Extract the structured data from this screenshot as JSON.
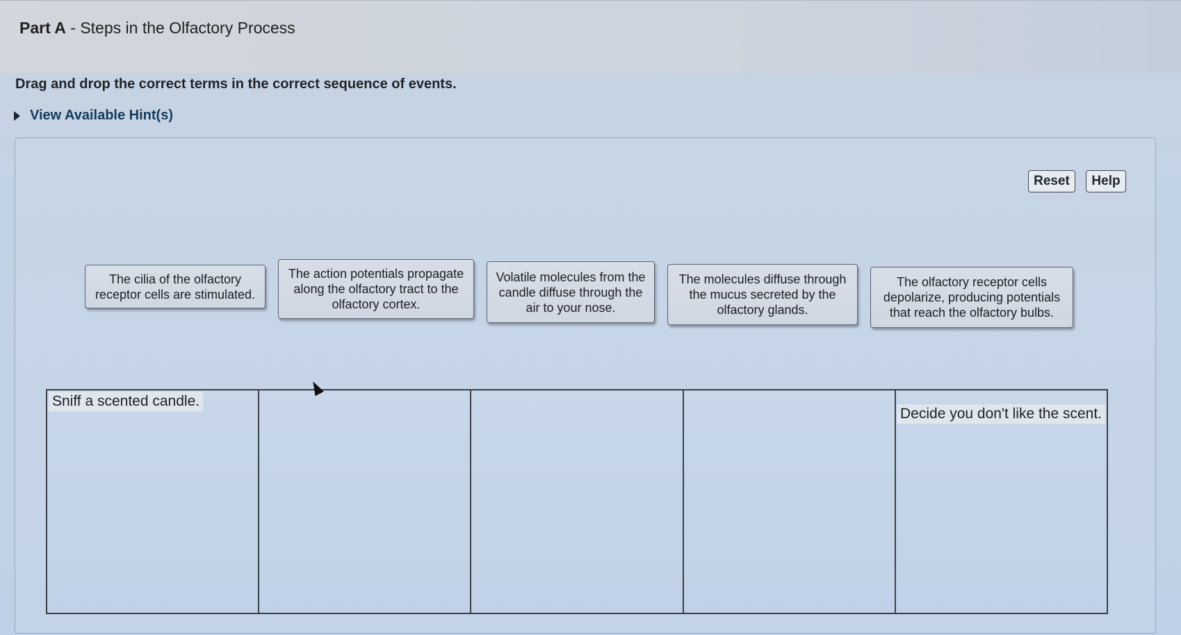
{
  "header": {
    "part_label": "Part A",
    "part_title": " - Steps in the Olfactory Process"
  },
  "instructions": "Drag and drop the correct terms in the correct sequence of events.",
  "hints_link": "View Available Hint(s)",
  "toolbar": {
    "reset_label": "Reset",
    "help_label": "Help"
  },
  "terms": [
    "The cilia of the olfactory receptor cells are stimulated.",
    "The action potentials propagate along the olfactory tract to the olfactory cortex.",
    "Volatile molecules from the candle diffuse through the air to your nose.",
    "The molecules diffuse through the mucus secreted by the olfactory glands.",
    "The olfactory receptor cells depolarize, producing potentials that reach the olfactory bulbs."
  ],
  "sequence": {
    "first_label": "Sniff a scented candle.",
    "last_label": "Decide you don't like the scent."
  }
}
